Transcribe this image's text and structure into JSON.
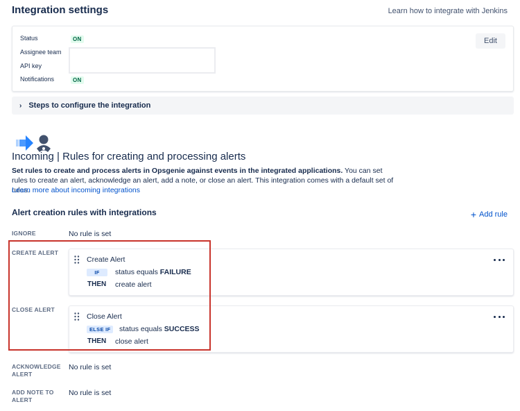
{
  "header": {
    "title": "Integration settings",
    "learn_link": "Learn how to integrate with Jenkins"
  },
  "settings": {
    "status_label": "Status",
    "status_value": "ON",
    "assignee_label": "Assignee team",
    "api_key_label": "API key",
    "notifications_label": "Notifications",
    "notifications_value": "ON",
    "edit_label": "Edit"
  },
  "steps": {
    "chevron": "›",
    "label": "Steps to configure the integration"
  },
  "incoming": {
    "title": "Incoming | Rules for creating and processing alerts",
    "desc_bold": "Set rules to create and process alerts in Opsgenie against events in the integrated applications.",
    "desc_rest": " You can set rules to create an alert, acknowledge an alert, add a note, or close an alert. This integration comes with a default set of rules.",
    "learn_more": "Learn more about incoming integrations"
  },
  "rules": {
    "title": "Alert creation rules with integrations",
    "add_rule": "Add rule",
    "ignore": {
      "label": "IGNORE",
      "value": "No rule is set"
    },
    "create": {
      "label": "CREATE ALERT",
      "name": "Create Alert",
      "cond_badge": "IF",
      "cond_text": "status equals ",
      "cond_value": "FAILURE",
      "then_label": "THEN",
      "then_text": "create alert"
    },
    "close": {
      "label": "CLOSE ALERT",
      "name": "Close Alert",
      "cond_badge": "ELSE IF",
      "cond_text": "status equals ",
      "cond_value": "SUCCESS",
      "then_label": "THEN",
      "then_text": "close alert"
    },
    "acknowledge": {
      "label_line1": "ACKNOWLEDGE",
      "label_line2": "ALERT",
      "value": "No rule is set"
    },
    "add_note": {
      "label_line1": "ADD NOTE TO",
      "label_line2": "ALERT",
      "value": "No rule is set"
    }
  },
  "colors": {
    "accent": "#0052cc",
    "on_badge_bg": "#e3fcef",
    "on_badge_text": "#006644",
    "highlight": "#c8332b",
    "arrow_blue": "#2684ff"
  }
}
